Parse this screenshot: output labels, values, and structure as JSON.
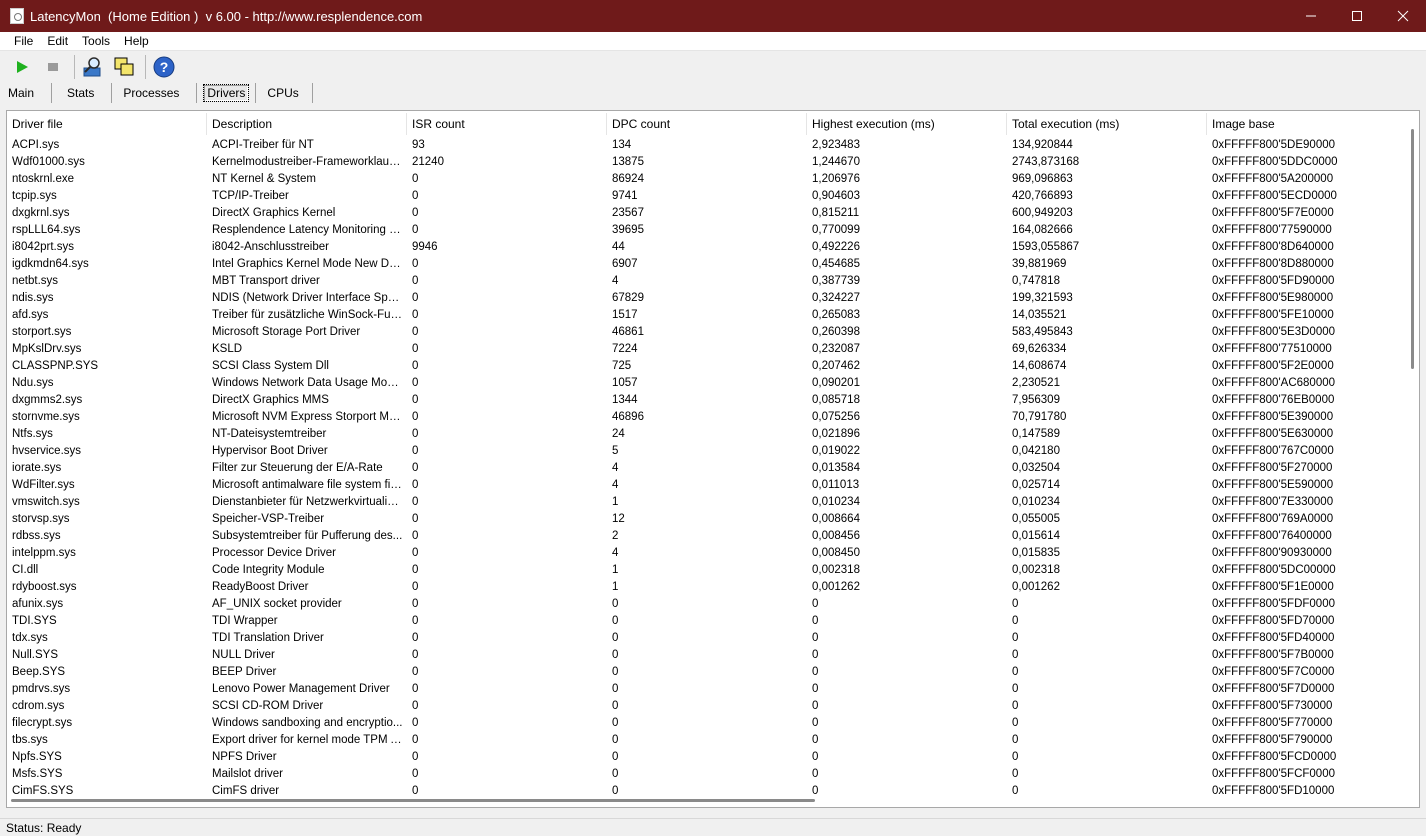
{
  "window": {
    "title": "LatencyMon  (Home Edition )  v 6.00 - http://www.resplendence.com",
    "controls": {
      "minimize": "—",
      "maximize": "□",
      "close": "✕"
    }
  },
  "menu": [
    {
      "label": "File"
    },
    {
      "label": "Edit"
    },
    {
      "label": "Tools"
    },
    {
      "label": "Help"
    }
  ],
  "toolbar": {
    "icons": [
      "play-icon",
      "stop-icon",
      "search-driver-icon",
      "windows-icon",
      "help-icon"
    ],
    "colors": {
      "play": "#1fb11f",
      "stop": "#9a9a9a",
      "help": "#2d63c8"
    }
  },
  "tabs": [
    {
      "label": "Main"
    },
    {
      "label": "Stats"
    },
    {
      "label": "Processes"
    },
    {
      "label": "Drivers",
      "active": true
    },
    {
      "label": "CPUs"
    }
  ],
  "table": {
    "columns": [
      "Driver file",
      "Description",
      "ISR count",
      "DPC count",
      "Highest execution (ms)",
      "Total execution (ms)",
      "Image base"
    ],
    "rows": [
      [
        "ACPI.sys",
        "ACPI-Treiber für NT",
        "93",
        "134",
        "2,923483",
        "134,920844",
        "0xFFFFF800'5DE90000"
      ],
      [
        "Wdf01000.sys",
        "Kernelmodustreiber-Frameworklaufzeit",
        "21240",
        "13875",
        "1,244670",
        "2743,873168",
        "0xFFFFF800'5DDC0000"
      ],
      [
        "ntoskrnl.exe",
        "NT Kernel & System",
        "0",
        "86924",
        "1,206976",
        "969,096863",
        "0xFFFFF800'5A200000"
      ],
      [
        "tcpip.sys",
        "TCP/IP-Treiber",
        "0",
        "9741",
        "0,904603",
        "420,766893",
        "0xFFFFF800'5ECD0000"
      ],
      [
        "dxgkrnl.sys",
        "DirectX Graphics Kernel",
        "0",
        "23567",
        "0,815211",
        "600,949203",
        "0xFFFFF800'5F7E0000"
      ],
      [
        "rspLLL64.sys",
        "Resplendence Latency Monitoring a...",
        "0",
        "39695",
        "0,770099",
        "164,082666",
        "0xFFFFF800'77590000"
      ],
      [
        "i8042prt.sys",
        "i8042-Anschlusstreiber",
        "9946",
        "44",
        "0,492226",
        "1593,055867",
        "0xFFFFF800'8D640000"
      ],
      [
        "igdkmdn64.sys",
        "Intel Graphics Kernel Mode New Driver",
        "0",
        "6907",
        "0,454685",
        "39,881969",
        "0xFFFFF800'8D880000"
      ],
      [
        "netbt.sys",
        "MBT Transport driver",
        "0",
        "4",
        "0,387739",
        "0,747818",
        "0xFFFFF800'5FD90000"
      ],
      [
        "ndis.sys",
        "NDIS (Network Driver Interface Spe...",
        "0",
        "67829",
        "0,324227",
        "199,321593",
        "0xFFFFF800'5E980000"
      ],
      [
        "afd.sys",
        "Treiber für zusätzliche WinSock-Fun...",
        "0",
        "1517",
        "0,265083",
        "14,035521",
        "0xFFFFF800'5FE10000"
      ],
      [
        "storport.sys",
        "Microsoft Storage Port Driver",
        "0",
        "46861",
        "0,260398",
        "583,495843",
        "0xFFFFF800'5E3D0000"
      ],
      [
        "MpKslDrv.sys",
        "KSLD",
        "0",
        "7224",
        "0,232087",
        "69,626334",
        "0xFFFFF800'77510000"
      ],
      [
        "CLASSPNP.SYS",
        "SCSI Class System Dll",
        "0",
        "725",
        "0,207462",
        "14,608674",
        "0xFFFFF800'5F2E0000"
      ],
      [
        "Ndu.sys",
        "Windows Network Data Usage Monit...",
        "0",
        "1057",
        "0,090201",
        "2,230521",
        "0xFFFFF800'AC680000"
      ],
      [
        "dxgmms2.sys",
        "DirectX Graphics MMS",
        "0",
        "1344",
        "0,085718",
        "7,956309",
        "0xFFFFF800'76EB0000"
      ],
      [
        "stornvme.sys",
        "Microsoft NVM Express Storport Mini...",
        "0",
        "46896",
        "0,075256",
        "70,791780",
        "0xFFFFF800'5E390000"
      ],
      [
        "Ntfs.sys",
        "NT-Dateisystemtreiber",
        "0",
        "24",
        "0,021896",
        "0,147589",
        "0xFFFFF800'5E630000"
      ],
      [
        "hvservice.sys",
        "Hypervisor Boot Driver",
        "0",
        "5",
        "0,019022",
        "0,042180",
        "0xFFFFF800'767C0000"
      ],
      [
        "iorate.sys",
        "Filter zur Steuerung der E/A-Rate",
        "0",
        "4",
        "0,013584",
        "0,032504",
        "0xFFFFF800'5F270000"
      ],
      [
        "WdFilter.sys",
        "Microsoft antimalware file system filt...",
        "0",
        "4",
        "0,011013",
        "0,025714",
        "0xFFFFF800'5E590000"
      ],
      [
        "vmswitch.sys",
        "Dienstanbieter für Netzwerkvirtualisi...",
        "0",
        "1",
        "0,010234",
        "0,010234",
        "0xFFFFF800'7E330000"
      ],
      [
        "storvsp.sys",
        "Speicher-VSP-Treiber",
        "0",
        "12",
        "0,008664",
        "0,055005",
        "0xFFFFF800'769A0000"
      ],
      [
        "rdbss.sys",
        "Subsystemtreiber für Pufferung des...",
        "0",
        "2",
        "0,008456",
        "0,015614",
        "0xFFFFF800'76400000"
      ],
      [
        "intelppm.sys",
        "Processor Device Driver",
        "0",
        "4",
        "0,008450",
        "0,015835",
        "0xFFFFF800'90930000"
      ],
      [
        "CI.dll",
        "Code Integrity Module",
        "0",
        "1",
        "0,002318",
        "0,002318",
        "0xFFFFF800'5DC00000"
      ],
      [
        "rdyboost.sys",
        "ReadyBoost Driver",
        "0",
        "1",
        "0,001262",
        "0,001262",
        "0xFFFFF800'5F1E0000"
      ],
      [
        "afunix.sys",
        "AF_UNIX socket provider",
        "0",
        "0",
        "0",
        "0",
        "0xFFFFF800'5FDF0000"
      ],
      [
        "TDI.SYS",
        "TDI Wrapper",
        "0",
        "0",
        "0",
        "0",
        "0xFFFFF800'5FD70000"
      ],
      [
        "tdx.sys",
        "TDI Translation Driver",
        "0",
        "0",
        "0",
        "0",
        "0xFFFFF800'5FD40000"
      ],
      [
        "Null.SYS",
        "NULL Driver",
        "0",
        "0",
        "0",
        "0",
        "0xFFFFF800'5F7B0000"
      ],
      [
        "Beep.SYS",
        "BEEP Driver",
        "0",
        "0",
        "0",
        "0",
        "0xFFFFF800'5F7C0000"
      ],
      [
        "pmdrvs.sys",
        "Lenovo Power Management Driver",
        "0",
        "0",
        "0",
        "0",
        "0xFFFFF800'5F7D0000"
      ],
      [
        "cdrom.sys",
        "SCSI CD-ROM Driver",
        "0",
        "0",
        "0",
        "0",
        "0xFFFFF800'5F730000"
      ],
      [
        "filecrypt.sys",
        "Windows sandboxing and encryptio...",
        "0",
        "0",
        "0",
        "0",
        "0xFFFFF800'5F770000"
      ],
      [
        "tbs.sys",
        "Export driver for kernel mode TPM API",
        "0",
        "0",
        "0",
        "0",
        "0xFFFFF800'5F790000"
      ],
      [
        "Npfs.SYS",
        "NPFS Driver",
        "0",
        "0",
        "0",
        "0",
        "0xFFFFF800'5FCD0000"
      ],
      [
        "Msfs.SYS",
        "Mailslot driver",
        "0",
        "0",
        "0",
        "0",
        "0xFFFFF800'5FCF0000"
      ],
      [
        "CimFS.SYS",
        "CimFS driver",
        "0",
        "0",
        "0",
        "0",
        "0xFFFFF800'5FD10000"
      ]
    ]
  },
  "status": {
    "text": "Status: Ready"
  }
}
